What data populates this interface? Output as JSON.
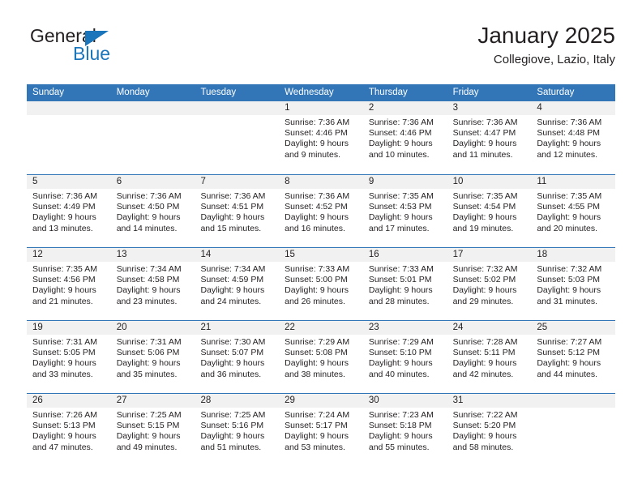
{
  "brand": {
    "name_part1": "General",
    "name_part2": "Blue",
    "triangle_color": "#1b75bb"
  },
  "header": {
    "title": "January 2025",
    "subtitle": "Collegiove, Lazio, Italy"
  },
  "theme": {
    "header_blue": "#3276b8",
    "day_band_gray": "#f1f1f1",
    "text_color": "#231f20"
  },
  "weekdays": [
    "Sunday",
    "Monday",
    "Tuesday",
    "Wednesday",
    "Thursday",
    "Friday",
    "Saturday"
  ],
  "weeks": [
    [
      {
        "empty": true
      },
      {
        "empty": true
      },
      {
        "empty": true
      },
      {
        "day": "1",
        "sunrise": "Sunrise: 7:36 AM",
        "sunset": "Sunset: 4:46 PM",
        "daylight_line1": "Daylight: 9 hours",
        "daylight_line2": "and 9 minutes."
      },
      {
        "day": "2",
        "sunrise": "Sunrise: 7:36 AM",
        "sunset": "Sunset: 4:46 PM",
        "daylight_line1": "Daylight: 9 hours",
        "daylight_line2": "and 10 minutes."
      },
      {
        "day": "3",
        "sunrise": "Sunrise: 7:36 AM",
        "sunset": "Sunset: 4:47 PM",
        "daylight_line1": "Daylight: 9 hours",
        "daylight_line2": "and 11 minutes."
      },
      {
        "day": "4",
        "sunrise": "Sunrise: 7:36 AM",
        "sunset": "Sunset: 4:48 PM",
        "daylight_line1": "Daylight: 9 hours",
        "daylight_line2": "and 12 minutes."
      }
    ],
    [
      {
        "day": "5",
        "sunrise": "Sunrise: 7:36 AM",
        "sunset": "Sunset: 4:49 PM",
        "daylight_line1": "Daylight: 9 hours",
        "daylight_line2": "and 13 minutes."
      },
      {
        "day": "6",
        "sunrise": "Sunrise: 7:36 AM",
        "sunset": "Sunset: 4:50 PM",
        "daylight_line1": "Daylight: 9 hours",
        "daylight_line2": "and 14 minutes."
      },
      {
        "day": "7",
        "sunrise": "Sunrise: 7:36 AM",
        "sunset": "Sunset: 4:51 PM",
        "daylight_line1": "Daylight: 9 hours",
        "daylight_line2": "and 15 minutes."
      },
      {
        "day": "8",
        "sunrise": "Sunrise: 7:36 AM",
        "sunset": "Sunset: 4:52 PM",
        "daylight_line1": "Daylight: 9 hours",
        "daylight_line2": "and 16 minutes."
      },
      {
        "day": "9",
        "sunrise": "Sunrise: 7:35 AM",
        "sunset": "Sunset: 4:53 PM",
        "daylight_line1": "Daylight: 9 hours",
        "daylight_line2": "and 17 minutes."
      },
      {
        "day": "10",
        "sunrise": "Sunrise: 7:35 AM",
        "sunset": "Sunset: 4:54 PM",
        "daylight_line1": "Daylight: 9 hours",
        "daylight_line2": "and 19 minutes."
      },
      {
        "day": "11",
        "sunrise": "Sunrise: 7:35 AM",
        "sunset": "Sunset: 4:55 PM",
        "daylight_line1": "Daylight: 9 hours",
        "daylight_line2": "and 20 minutes."
      }
    ],
    [
      {
        "day": "12",
        "sunrise": "Sunrise: 7:35 AM",
        "sunset": "Sunset: 4:56 PM",
        "daylight_line1": "Daylight: 9 hours",
        "daylight_line2": "and 21 minutes."
      },
      {
        "day": "13",
        "sunrise": "Sunrise: 7:34 AM",
        "sunset": "Sunset: 4:58 PM",
        "daylight_line1": "Daylight: 9 hours",
        "daylight_line2": "and 23 minutes."
      },
      {
        "day": "14",
        "sunrise": "Sunrise: 7:34 AM",
        "sunset": "Sunset: 4:59 PM",
        "daylight_line1": "Daylight: 9 hours",
        "daylight_line2": "and 24 minutes."
      },
      {
        "day": "15",
        "sunrise": "Sunrise: 7:33 AM",
        "sunset": "Sunset: 5:00 PM",
        "daylight_line1": "Daylight: 9 hours",
        "daylight_line2": "and 26 minutes."
      },
      {
        "day": "16",
        "sunrise": "Sunrise: 7:33 AM",
        "sunset": "Sunset: 5:01 PM",
        "daylight_line1": "Daylight: 9 hours",
        "daylight_line2": "and 28 minutes."
      },
      {
        "day": "17",
        "sunrise": "Sunrise: 7:32 AM",
        "sunset": "Sunset: 5:02 PM",
        "daylight_line1": "Daylight: 9 hours",
        "daylight_line2": "and 29 minutes."
      },
      {
        "day": "18",
        "sunrise": "Sunrise: 7:32 AM",
        "sunset": "Sunset: 5:03 PM",
        "daylight_line1": "Daylight: 9 hours",
        "daylight_line2": "and 31 minutes."
      }
    ],
    [
      {
        "day": "19",
        "sunrise": "Sunrise: 7:31 AM",
        "sunset": "Sunset: 5:05 PM",
        "daylight_line1": "Daylight: 9 hours",
        "daylight_line2": "and 33 minutes."
      },
      {
        "day": "20",
        "sunrise": "Sunrise: 7:31 AM",
        "sunset": "Sunset: 5:06 PM",
        "daylight_line1": "Daylight: 9 hours",
        "daylight_line2": "and 35 minutes."
      },
      {
        "day": "21",
        "sunrise": "Sunrise: 7:30 AM",
        "sunset": "Sunset: 5:07 PM",
        "daylight_line1": "Daylight: 9 hours",
        "daylight_line2": "and 36 minutes."
      },
      {
        "day": "22",
        "sunrise": "Sunrise: 7:29 AM",
        "sunset": "Sunset: 5:08 PM",
        "daylight_line1": "Daylight: 9 hours",
        "daylight_line2": "and 38 minutes."
      },
      {
        "day": "23",
        "sunrise": "Sunrise: 7:29 AM",
        "sunset": "Sunset: 5:10 PM",
        "daylight_line1": "Daylight: 9 hours",
        "daylight_line2": "and 40 minutes."
      },
      {
        "day": "24",
        "sunrise": "Sunrise: 7:28 AM",
        "sunset": "Sunset: 5:11 PM",
        "daylight_line1": "Daylight: 9 hours",
        "daylight_line2": "and 42 minutes."
      },
      {
        "day": "25",
        "sunrise": "Sunrise: 7:27 AM",
        "sunset": "Sunset: 5:12 PM",
        "daylight_line1": "Daylight: 9 hours",
        "daylight_line2": "and 44 minutes."
      }
    ],
    [
      {
        "day": "26",
        "sunrise": "Sunrise: 7:26 AM",
        "sunset": "Sunset: 5:13 PM",
        "daylight_line1": "Daylight: 9 hours",
        "daylight_line2": "and 47 minutes."
      },
      {
        "day": "27",
        "sunrise": "Sunrise: 7:25 AM",
        "sunset": "Sunset: 5:15 PM",
        "daylight_line1": "Daylight: 9 hours",
        "daylight_line2": "and 49 minutes."
      },
      {
        "day": "28",
        "sunrise": "Sunrise: 7:25 AM",
        "sunset": "Sunset: 5:16 PM",
        "daylight_line1": "Daylight: 9 hours",
        "daylight_line2": "and 51 minutes."
      },
      {
        "day": "29",
        "sunrise": "Sunrise: 7:24 AM",
        "sunset": "Sunset: 5:17 PM",
        "daylight_line1": "Daylight: 9 hours",
        "daylight_line2": "and 53 minutes."
      },
      {
        "day": "30",
        "sunrise": "Sunrise: 7:23 AM",
        "sunset": "Sunset: 5:18 PM",
        "daylight_line1": "Daylight: 9 hours",
        "daylight_line2": "and 55 minutes."
      },
      {
        "day": "31",
        "sunrise": "Sunrise: 7:22 AM",
        "sunset": "Sunset: 5:20 PM",
        "daylight_line1": "Daylight: 9 hours",
        "daylight_line2": "and 58 minutes."
      },
      {
        "empty": true
      }
    ]
  ]
}
